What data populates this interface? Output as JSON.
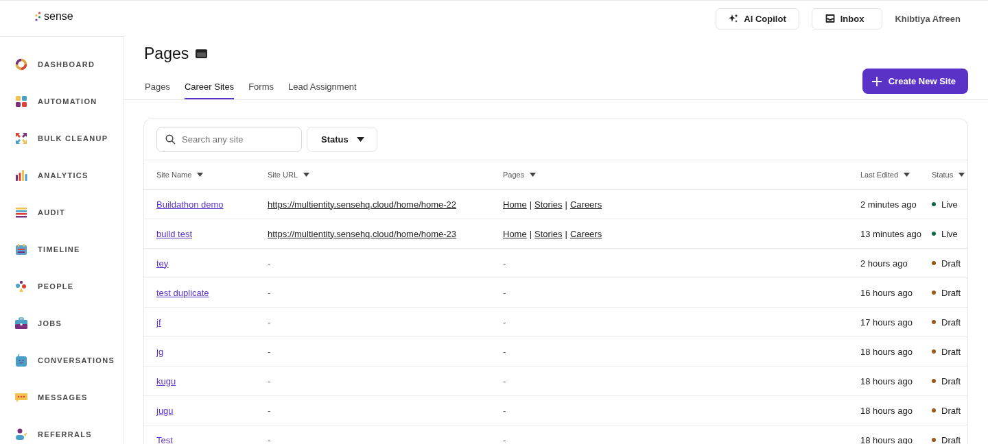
{
  "logo": "sense",
  "topbar": {
    "copilot": "AI Copilot",
    "inbox": "Inbox",
    "user": "Khibtiya Afreen"
  },
  "sidebar": {
    "items": [
      {
        "label": "DASHBOARD"
      },
      {
        "label": "AUTOMATION"
      },
      {
        "label": "BULK CLEANUP"
      },
      {
        "label": "ANALYTICS"
      },
      {
        "label": "AUDIT"
      },
      {
        "label": "TIMELINE"
      },
      {
        "label": "PEOPLE"
      },
      {
        "label": "JOBS"
      },
      {
        "label": "CONVERSATIONS"
      },
      {
        "label": "MESSAGES"
      },
      {
        "label": "REFERRALS"
      }
    ]
  },
  "page": {
    "title": "Pages",
    "tabs": [
      {
        "label": "Pages",
        "selected": false
      },
      {
        "label": "Career Sites",
        "selected": true
      },
      {
        "label": "Forms",
        "selected": false
      },
      {
        "label": "Lead Assignment",
        "selected": false
      }
    ],
    "create_button": "Create New Site"
  },
  "filters": {
    "search_placeholder": "Search any site",
    "status": "Status"
  },
  "table": {
    "columns": [
      "Site Name",
      "Site URL",
      "Pages",
      "Last Edited",
      "Status"
    ],
    "page_separator": "|",
    "rows": [
      {
        "kind": "live",
        "name": "Buildathon demo",
        "url": "https://multientity.sensehq.cloud/home/home-22",
        "pages": [
          "Home",
          "Stories",
          "Careers"
        ],
        "edited": "2 minutes ago",
        "status": "Live",
        "color": "#0f6b45"
      },
      {
        "kind": "live",
        "name": "build test",
        "url": "https://multientity.sensehq.cloud/home/home-23",
        "pages": [
          "Home",
          "Stories",
          "Careers"
        ],
        "edited": "13 minutes ago",
        "status": "Live",
        "color": "#0f6b45"
      },
      {
        "kind": "draft",
        "name": "tey",
        "url": "-",
        "pages": [
          "-"
        ],
        "edited": "2 hours ago",
        "status": "Draft",
        "color": "#9a5a16"
      },
      {
        "kind": "draft",
        "name": "test duplicate",
        "url": "-",
        "pages": [
          "-"
        ],
        "edited": "16 hours ago",
        "status": "Draft",
        "color": "#9a5a16"
      },
      {
        "kind": "draft",
        "name": "jf",
        "url": "-",
        "pages": [
          "-"
        ],
        "edited": "17 hours ago",
        "status": "Draft",
        "color": "#9a5a16"
      },
      {
        "kind": "draft",
        "name": "jg",
        "url": "-",
        "pages": [
          "-"
        ],
        "edited": "18 hours ago",
        "status": "Draft",
        "color": "#9a5a16"
      },
      {
        "kind": "draft",
        "name": "kugu",
        "url": "-",
        "pages": [
          "-"
        ],
        "edited": "18 hours ago",
        "status": "Draft",
        "color": "#9a5a16"
      },
      {
        "kind": "draft",
        "name": "jugu",
        "url": "-",
        "pages": [
          "-"
        ],
        "edited": "18 hours ago",
        "status": "Draft",
        "color": "#9a5a16"
      },
      {
        "kind": "draft",
        "name": "Test",
        "url": "-",
        "pages": [
          "-"
        ],
        "edited": "18 hours ago",
        "status": "Draft",
        "color": "#9a5a16"
      }
    ]
  }
}
